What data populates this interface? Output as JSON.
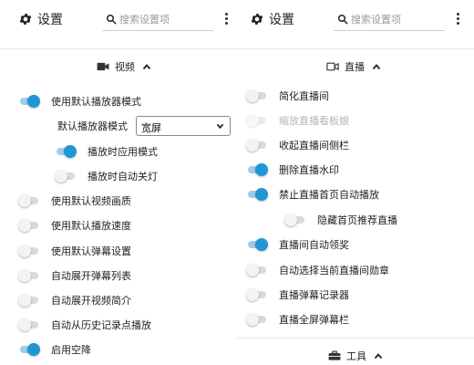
{
  "left": {
    "header": {
      "title": "设置",
      "search_placeholder": "搜索设置项"
    },
    "section": {
      "icon": "video-camera-icon",
      "label": "视频"
    },
    "rows": [
      {
        "label": "使用默认播放器模式",
        "on": true
      },
      {
        "label": "播放时应用模式",
        "on": true
      },
      {
        "label": "播放时自动关灯",
        "on": false
      },
      {
        "label": "使用默认视频画质",
        "on": false
      },
      {
        "label": "使用默认播放速度",
        "on": false
      },
      {
        "label": "使用默认弹幕设置",
        "on": false
      },
      {
        "label": "自动展开弹幕列表",
        "on": false
      },
      {
        "label": "自动展开视频简介",
        "on": false
      },
      {
        "label": "自动从历史记录点播放",
        "on": false
      },
      {
        "label": "启用空降",
        "on": true
      }
    ],
    "select": {
      "label": "默认播放器模式",
      "value": "宽屏"
    }
  },
  "right": {
    "header": {
      "title": "设置",
      "search_placeholder": "搜索设置项"
    },
    "section": {
      "icon": "live-camera-icon",
      "label": "直播"
    },
    "rows": [
      {
        "label": "简化直播间",
        "on": false,
        "disabled": false
      },
      {
        "label": "缩放直播看板娘",
        "on": false,
        "disabled": true
      },
      {
        "label": "收起直播间侧栏",
        "on": false,
        "disabled": false
      },
      {
        "label": "删除直播水印",
        "on": true,
        "disabled": false
      },
      {
        "label": "禁止直播首页自动播放",
        "on": true,
        "disabled": false
      },
      {
        "label": "隐藏首页推荐直播",
        "on": false,
        "disabled": false
      },
      {
        "label": "直播间自动领奖",
        "on": true,
        "disabled": false
      },
      {
        "label": "自动选择当前直播间勋章",
        "on": false,
        "disabled": false
      },
      {
        "label": "直播弹幕记录器",
        "on": false,
        "disabled": false
      },
      {
        "label": "直播全屏弹幕栏",
        "on": false,
        "disabled": false
      }
    ],
    "section2": {
      "icon": "toolbox-icon",
      "label": "工具"
    }
  },
  "colors": {
    "accent": "#2196d6",
    "track_on": "#9fcde9",
    "track_off": "#dadada"
  }
}
